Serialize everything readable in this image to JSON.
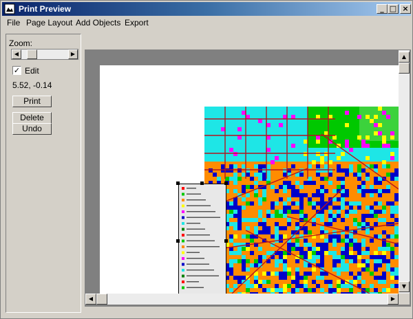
{
  "window": {
    "title": "Print Preview",
    "controls": {
      "minimize": "_",
      "maximize": "□",
      "close": "×"
    }
  },
  "menu": [
    "File",
    "Page Layout",
    "Add Objects",
    "Export"
  ],
  "panel": {
    "zoom_label": "Zoom:",
    "zoom_value": 0.14,
    "edit_label": "Edit",
    "edit_checked": true,
    "check_mark": "✓",
    "coords": "5.52, -0.14",
    "buttons": {
      "print": "Print",
      "delete": "Delete",
      "undo": "Undo"
    }
  },
  "scroll": {
    "up": "▲",
    "down": "▼",
    "left": "◀",
    "right": "▶"
  },
  "colors": {
    "titlebar_start": "#0a246a",
    "map_cyan": "#1ee6e6",
    "map_orange": "#ff8c00",
    "map_blue": "#0000c8",
    "map_green": "#00c800",
    "map_road": "#b4141e"
  }
}
